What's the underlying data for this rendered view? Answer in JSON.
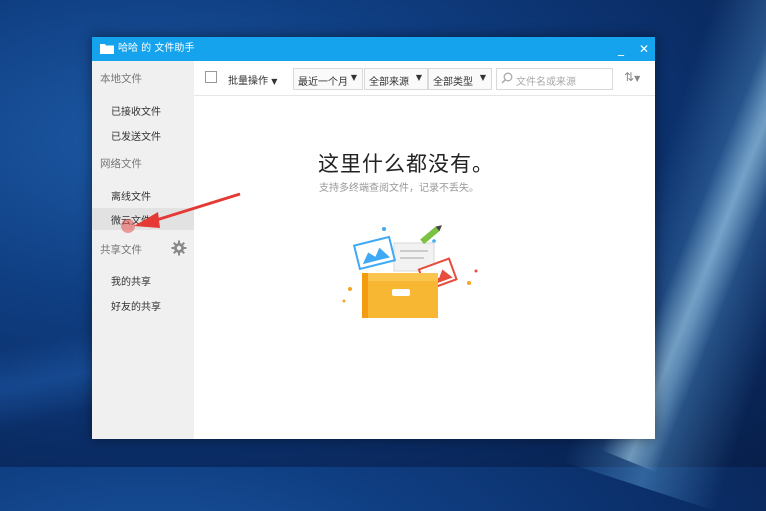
{
  "window": {
    "title": "哈哈 的 文件助手",
    "minimize_symbol": "_",
    "close_symbol": "✕"
  },
  "sidebar": {
    "groups": [
      {
        "label": "本地文件",
        "items": [
          "已接收文件",
          "已发送文件"
        ]
      },
      {
        "label": "网络文件",
        "items": [
          "离线文件",
          "微云文件"
        ]
      },
      {
        "label": "共享文件",
        "items": [
          "我的共享",
          "好友的共享"
        ]
      }
    ],
    "active_item": "微云文件",
    "settings_icon": "gear-icon"
  },
  "toolbar": {
    "batch_label": "批量操作",
    "time_filter": "最近一个月",
    "source_filter": "全部来源",
    "type_filter": "全部类型",
    "search_placeholder": "文件名或来源",
    "sort_icon": "sort-icon"
  },
  "empty_state": {
    "title": "这里什么都没有。",
    "subtitle": "支持多终端查阅文件，记录不丢失。"
  },
  "colors": {
    "titlebar": "#15a3ee",
    "sidebar_bg": "#f0f0f0",
    "active_item_bg": "#e2e2e2",
    "annotation_arrow": "#e53935"
  }
}
